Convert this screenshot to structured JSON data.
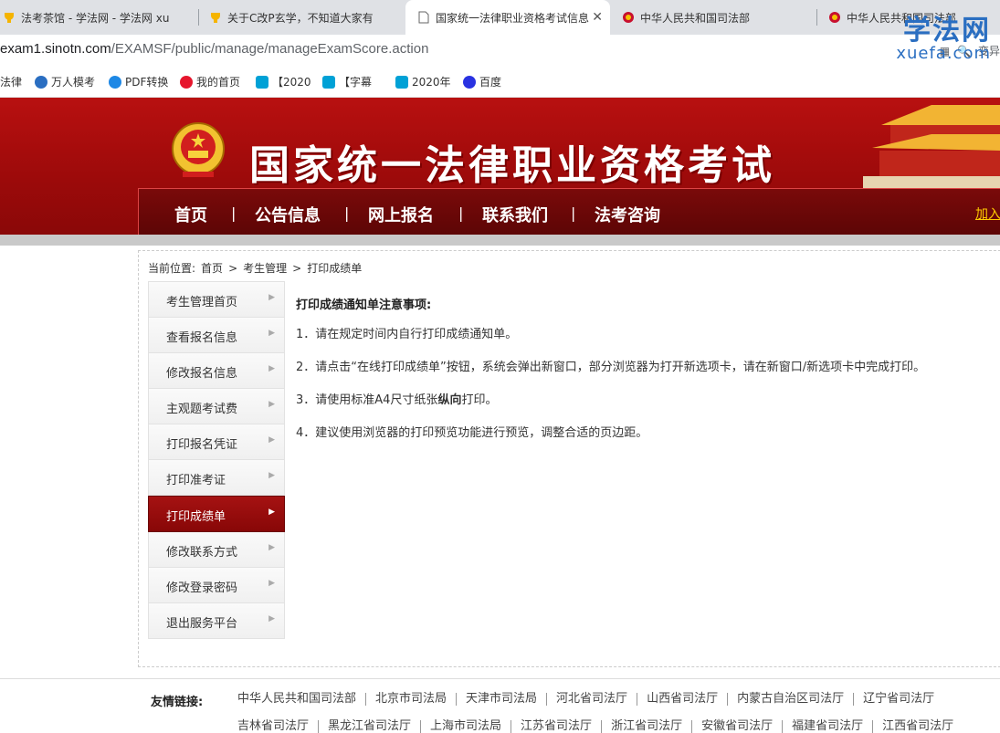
{
  "browser": {
    "tabs": [
      {
        "title": "法考茶馆 - 学法网 - 学法网 xu",
        "active": false
      },
      {
        "title": "关于C改P玄学，不知道大家有",
        "active": false
      },
      {
        "title": "国家统一法律职业资格考试信息",
        "active": true
      },
      {
        "title": "中华人民共和国司法部",
        "active": false
      },
      {
        "title": "中华人民共和国司法部",
        "active": false
      }
    ],
    "url_host": "exam1.sinotn.com",
    "url_path": "/EXAMSF/public/manage/manageExamScore.action",
    "right_text": "变异",
    "bookmarks": [
      "法律",
      "万人模考",
      "PDF转换",
      "我的首页",
      "【2020",
      "【字幕",
      "2020年",
      "百度"
    ]
  },
  "watermark": {
    "line1": "学法网",
    "line2": "xuefa.com"
  },
  "site": {
    "title": "国家统一法律职业资格考试",
    "nav": [
      "首页",
      "公告信息",
      "网上报名",
      "联系我们",
      "法考咨询"
    ],
    "nav_sep": "|",
    "nav_right": "加入"
  },
  "breadcrumb": {
    "prefix": "当前位置:",
    "items": [
      "首页",
      "考生管理",
      "打印成绩单"
    ],
    "sep": ">"
  },
  "sidebar": {
    "items": [
      {
        "label": "考生管理首页",
        "active": false
      },
      {
        "label": "查看报名信息",
        "active": false
      },
      {
        "label": "修改报名信息",
        "active": false
      },
      {
        "label": "主观题考试费",
        "active": false
      },
      {
        "label": "打印报名凭证",
        "active": false
      },
      {
        "label": "打印准考证",
        "active": false
      },
      {
        "label": "打印成绩单",
        "active": true
      },
      {
        "label": "修改联系方式",
        "active": false
      },
      {
        "label": "修改登录密码",
        "active": false
      },
      {
        "label": "退出服务平台",
        "active": false
      }
    ]
  },
  "notice": {
    "title": "打印成绩通知单注意事项:",
    "items": [
      {
        "text": "1．请在规定时间内自行打印成绩通知单。"
      },
      {
        "text": "2．请点击“在线打印成绩单”按钮，系统会弹出新窗口，部分浏览器为打开新选项卡，请在新窗口/新选项卡中完成打印。"
      },
      {
        "pre": "3．请使用标准A4尺寸纸张",
        "bold": "纵向",
        "post": "打印。"
      },
      {
        "text": "4．建议使用浏览器的打印预览功能进行预览，调整合适的页边距。"
      }
    ]
  },
  "footer": {
    "label": "友情链接:",
    "row1": [
      "中华人民共和国司法部",
      "北京市司法局",
      "天津市司法局",
      "河北省司法厅",
      "山西省司法厅",
      "内蒙古自治区司法厅",
      "辽宁省司法厅"
    ],
    "row2": [
      "吉林省司法厅",
      "黑龙江省司法厅",
      "上海市司法局",
      "江苏省司法厅",
      "浙江省司法厅",
      "安徽省司法厅",
      "福建省司法厅",
      "江西省司法厅"
    ]
  },
  "colors": {
    "brand_red": "#9c0a0a",
    "nav_red": "#6a0707",
    "active_menu": "#9a0f0f",
    "accent_gold": "#ffcc00"
  }
}
